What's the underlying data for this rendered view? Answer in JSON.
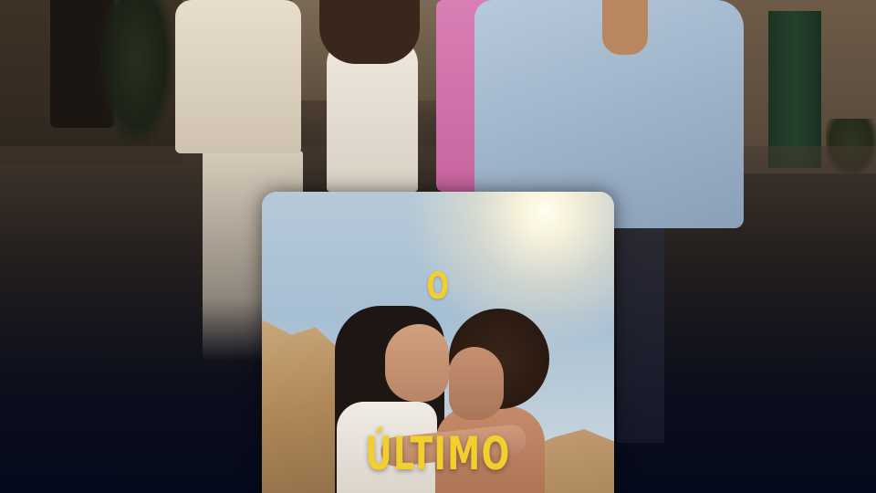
{
  "poster": {
    "title_line_1": "O",
    "title_line_2": "ÚLTIMO"
  },
  "colors": {
    "title_yellow": "#f2cf2e",
    "screen_background": "#050a1c"
  }
}
